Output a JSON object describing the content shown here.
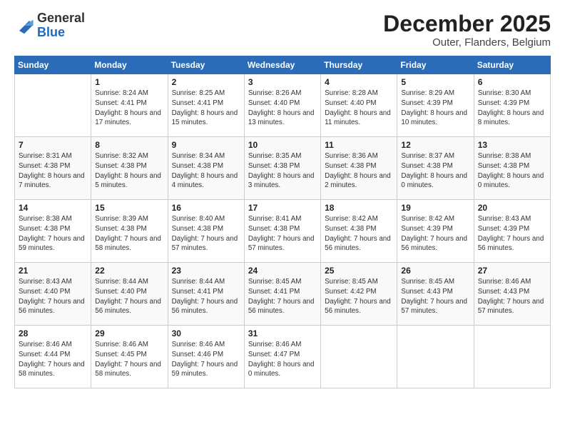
{
  "logo": {
    "line1": "General",
    "line2": "Blue"
  },
  "title": "December 2025",
  "subtitle": "Outer, Flanders, Belgium",
  "weekdays": [
    "Sunday",
    "Monday",
    "Tuesday",
    "Wednesday",
    "Thursday",
    "Friday",
    "Saturday"
  ],
  "weeks": [
    [
      {
        "day": "",
        "sunrise": "",
        "sunset": "",
        "daylight": ""
      },
      {
        "day": "1",
        "sunrise": "Sunrise: 8:24 AM",
        "sunset": "Sunset: 4:41 PM",
        "daylight": "Daylight: 8 hours and 17 minutes."
      },
      {
        "day": "2",
        "sunrise": "Sunrise: 8:25 AM",
        "sunset": "Sunset: 4:41 PM",
        "daylight": "Daylight: 8 hours and 15 minutes."
      },
      {
        "day": "3",
        "sunrise": "Sunrise: 8:26 AM",
        "sunset": "Sunset: 4:40 PM",
        "daylight": "Daylight: 8 hours and 13 minutes."
      },
      {
        "day": "4",
        "sunrise": "Sunrise: 8:28 AM",
        "sunset": "Sunset: 4:40 PM",
        "daylight": "Daylight: 8 hours and 11 minutes."
      },
      {
        "day": "5",
        "sunrise": "Sunrise: 8:29 AM",
        "sunset": "Sunset: 4:39 PM",
        "daylight": "Daylight: 8 hours and 10 minutes."
      },
      {
        "day": "6",
        "sunrise": "Sunrise: 8:30 AM",
        "sunset": "Sunset: 4:39 PM",
        "daylight": "Daylight: 8 hours and 8 minutes."
      }
    ],
    [
      {
        "day": "7",
        "sunrise": "Sunrise: 8:31 AM",
        "sunset": "Sunset: 4:38 PM",
        "daylight": "Daylight: 8 hours and 7 minutes."
      },
      {
        "day": "8",
        "sunrise": "Sunrise: 8:32 AM",
        "sunset": "Sunset: 4:38 PM",
        "daylight": "Daylight: 8 hours and 5 minutes."
      },
      {
        "day": "9",
        "sunrise": "Sunrise: 8:34 AM",
        "sunset": "Sunset: 4:38 PM",
        "daylight": "Daylight: 8 hours and 4 minutes."
      },
      {
        "day": "10",
        "sunrise": "Sunrise: 8:35 AM",
        "sunset": "Sunset: 4:38 PM",
        "daylight": "Daylight: 8 hours and 3 minutes."
      },
      {
        "day": "11",
        "sunrise": "Sunrise: 8:36 AM",
        "sunset": "Sunset: 4:38 PM",
        "daylight": "Daylight: 8 hours and 2 minutes."
      },
      {
        "day": "12",
        "sunrise": "Sunrise: 8:37 AM",
        "sunset": "Sunset: 4:38 PM",
        "daylight": "Daylight: 8 hours and 0 minutes."
      },
      {
        "day": "13",
        "sunrise": "Sunrise: 8:38 AM",
        "sunset": "Sunset: 4:38 PM",
        "daylight": "Daylight: 8 hours and 0 minutes."
      }
    ],
    [
      {
        "day": "14",
        "sunrise": "Sunrise: 8:38 AM",
        "sunset": "Sunset: 4:38 PM",
        "daylight": "Daylight: 7 hours and 59 minutes."
      },
      {
        "day": "15",
        "sunrise": "Sunrise: 8:39 AM",
        "sunset": "Sunset: 4:38 PM",
        "daylight": "Daylight: 7 hours and 58 minutes."
      },
      {
        "day": "16",
        "sunrise": "Sunrise: 8:40 AM",
        "sunset": "Sunset: 4:38 PM",
        "daylight": "Daylight: 7 hours and 57 minutes."
      },
      {
        "day": "17",
        "sunrise": "Sunrise: 8:41 AM",
        "sunset": "Sunset: 4:38 PM",
        "daylight": "Daylight: 7 hours and 57 minutes."
      },
      {
        "day": "18",
        "sunrise": "Sunrise: 8:42 AM",
        "sunset": "Sunset: 4:38 PM",
        "daylight": "Daylight: 7 hours and 56 minutes."
      },
      {
        "day": "19",
        "sunrise": "Sunrise: 8:42 AM",
        "sunset": "Sunset: 4:39 PM",
        "daylight": "Daylight: 7 hours and 56 minutes."
      },
      {
        "day": "20",
        "sunrise": "Sunrise: 8:43 AM",
        "sunset": "Sunset: 4:39 PM",
        "daylight": "Daylight: 7 hours and 56 minutes."
      }
    ],
    [
      {
        "day": "21",
        "sunrise": "Sunrise: 8:43 AM",
        "sunset": "Sunset: 4:40 PM",
        "daylight": "Daylight: 7 hours and 56 minutes."
      },
      {
        "day": "22",
        "sunrise": "Sunrise: 8:44 AM",
        "sunset": "Sunset: 4:40 PM",
        "daylight": "Daylight: 7 hours and 56 minutes."
      },
      {
        "day": "23",
        "sunrise": "Sunrise: 8:44 AM",
        "sunset": "Sunset: 4:41 PM",
        "daylight": "Daylight: 7 hours and 56 minutes."
      },
      {
        "day": "24",
        "sunrise": "Sunrise: 8:45 AM",
        "sunset": "Sunset: 4:41 PM",
        "daylight": "Daylight: 7 hours and 56 minutes."
      },
      {
        "day": "25",
        "sunrise": "Sunrise: 8:45 AM",
        "sunset": "Sunset: 4:42 PM",
        "daylight": "Daylight: 7 hours and 56 minutes."
      },
      {
        "day": "26",
        "sunrise": "Sunrise: 8:45 AM",
        "sunset": "Sunset: 4:43 PM",
        "daylight": "Daylight: 7 hours and 57 minutes."
      },
      {
        "day": "27",
        "sunrise": "Sunrise: 8:46 AM",
        "sunset": "Sunset: 4:43 PM",
        "daylight": "Daylight: 7 hours and 57 minutes."
      }
    ],
    [
      {
        "day": "28",
        "sunrise": "Sunrise: 8:46 AM",
        "sunset": "Sunset: 4:44 PM",
        "daylight": "Daylight: 7 hours and 58 minutes."
      },
      {
        "day": "29",
        "sunrise": "Sunrise: 8:46 AM",
        "sunset": "Sunset: 4:45 PM",
        "daylight": "Daylight: 7 hours and 58 minutes."
      },
      {
        "day": "30",
        "sunrise": "Sunrise: 8:46 AM",
        "sunset": "Sunset: 4:46 PM",
        "daylight": "Daylight: 7 hours and 59 minutes."
      },
      {
        "day": "31",
        "sunrise": "Sunrise: 8:46 AM",
        "sunset": "Sunset: 4:47 PM",
        "daylight": "Daylight: 8 hours and 0 minutes."
      },
      {
        "day": "",
        "sunrise": "",
        "sunset": "",
        "daylight": ""
      },
      {
        "day": "",
        "sunrise": "",
        "sunset": "",
        "daylight": ""
      },
      {
        "day": "",
        "sunrise": "",
        "sunset": "",
        "daylight": ""
      }
    ]
  ]
}
